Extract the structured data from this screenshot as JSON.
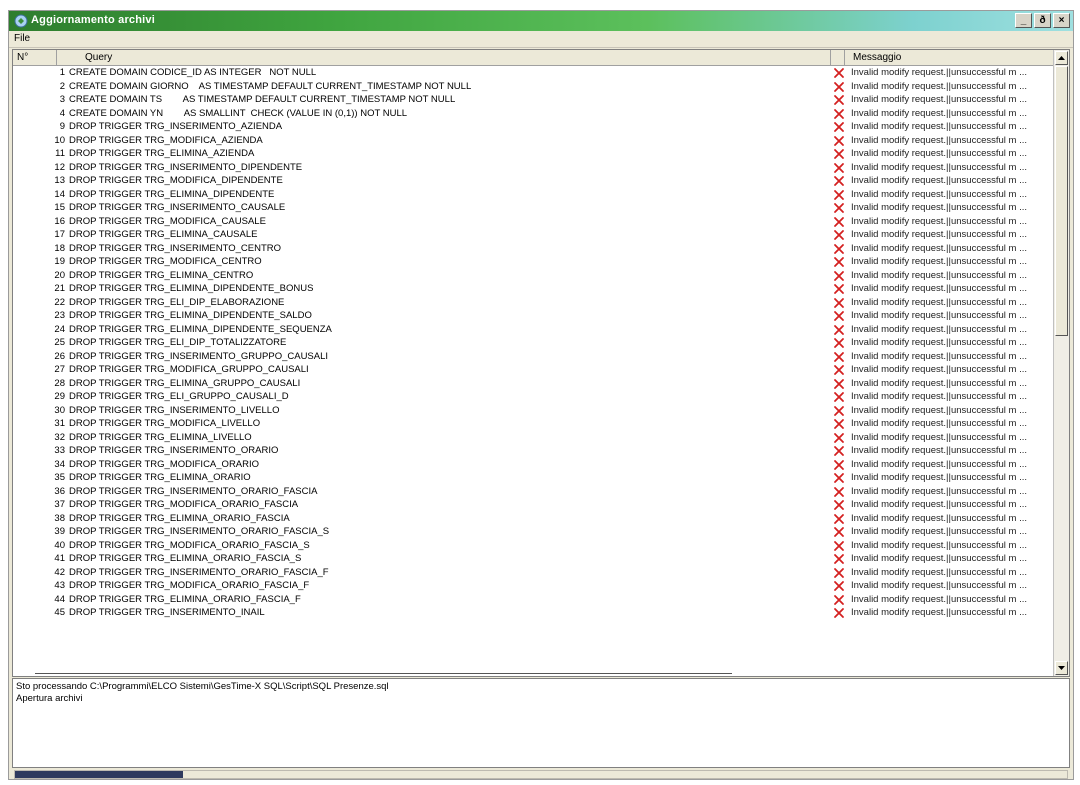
{
  "window": {
    "title": "Aggiornamento archivi",
    "controls": {
      "minimize": "_",
      "restore": "ð",
      "close": "×"
    }
  },
  "menu": {
    "file": "File"
  },
  "grid": {
    "columns": {
      "number": "N°",
      "query": "Query",
      "message": "Messaggio"
    },
    "status_icon": "red-x-icon",
    "rows": [
      {
        "n": "1",
        "query": "CREATE DOMAIN CODICE_ID AS INTEGER   NOT NULL",
        "msg": "Invalid modify request.||unsuccessful m ..."
      },
      {
        "n": "2",
        "query": "CREATE DOMAIN GIORNO    AS TIMESTAMP DEFAULT CURRENT_TIMESTAMP NOT NULL",
        "msg": "Invalid modify request.||unsuccessful m ..."
      },
      {
        "n": "3",
        "query": "CREATE DOMAIN TS        AS TIMESTAMP DEFAULT CURRENT_TIMESTAMP NOT NULL",
        "msg": "Invalid modify request.||unsuccessful m ..."
      },
      {
        "n": "4",
        "query": "CREATE DOMAIN YN        AS SMALLINT  CHECK (VALUE IN (0,1)) NOT NULL",
        "msg": "Invalid modify request.||unsuccessful m ..."
      },
      {
        "n": "9",
        "query": "DROP TRIGGER TRG_INSERIMENTO_AZIENDA",
        "msg": "Invalid modify request.||unsuccessful m ..."
      },
      {
        "n": "10",
        "query": "DROP TRIGGER TRG_MODIFICA_AZIENDA",
        "msg": "Invalid modify request.||unsuccessful m ..."
      },
      {
        "n": "11",
        "query": "DROP TRIGGER TRG_ELIMINA_AZIENDA",
        "msg": "Invalid modify request.||unsuccessful m ..."
      },
      {
        "n": "12",
        "query": "DROP TRIGGER TRG_INSERIMENTO_DIPENDENTE",
        "msg": "Invalid modify request.||unsuccessful m ..."
      },
      {
        "n": "13",
        "query": "DROP TRIGGER TRG_MODIFICA_DIPENDENTE",
        "msg": "Invalid modify request.||unsuccessful m ..."
      },
      {
        "n": "14",
        "query": "DROP TRIGGER TRG_ELIMINA_DIPENDENTE",
        "msg": "Invalid modify request.||unsuccessful m ..."
      },
      {
        "n": "15",
        "query": "DROP TRIGGER TRG_INSERIMENTO_CAUSALE",
        "msg": "Invalid modify request.||unsuccessful m ..."
      },
      {
        "n": "16",
        "query": "DROP TRIGGER TRG_MODIFICA_CAUSALE",
        "msg": "Invalid modify request.||unsuccessful m ..."
      },
      {
        "n": "17",
        "query": "DROP TRIGGER TRG_ELIMINA_CAUSALE",
        "msg": "Invalid modify request.||unsuccessful m ..."
      },
      {
        "n": "18",
        "query": "DROP TRIGGER TRG_INSERIMENTO_CENTRO",
        "msg": "Invalid modify request.||unsuccessful m ..."
      },
      {
        "n": "19",
        "query": "DROP TRIGGER TRG_MODIFICA_CENTRO",
        "msg": "Invalid modify request.||unsuccessful m ..."
      },
      {
        "n": "20",
        "query": "DROP TRIGGER TRG_ELIMINA_CENTRO",
        "msg": "Invalid modify request.||unsuccessful m ..."
      },
      {
        "n": "21",
        "query": "DROP TRIGGER TRG_ELIMINA_DIPENDENTE_BONUS",
        "msg": "Invalid modify request.||unsuccessful m ..."
      },
      {
        "n": "22",
        "query": "DROP TRIGGER TRG_ELI_DIP_ELABORAZIONE",
        "msg": "Invalid modify request.||unsuccessful m ..."
      },
      {
        "n": "23",
        "query": "DROP TRIGGER TRG_ELIMINA_DIPENDENTE_SALDO",
        "msg": "Invalid modify request.||unsuccessful m ..."
      },
      {
        "n": "24",
        "query": "DROP TRIGGER TRG_ELIMINA_DIPENDENTE_SEQUENZA",
        "msg": "Invalid modify request.||unsuccessful m ..."
      },
      {
        "n": "25",
        "query": "DROP TRIGGER TRG_ELI_DIP_TOTALIZZATORE",
        "msg": "Invalid modify request.||unsuccessful m ..."
      },
      {
        "n": "26",
        "query": "DROP TRIGGER TRG_INSERIMENTO_GRUPPO_CAUSALI",
        "msg": "Invalid modify request.||unsuccessful m ..."
      },
      {
        "n": "27",
        "query": "DROP TRIGGER TRG_MODIFICA_GRUPPO_CAUSALI",
        "msg": "Invalid modify request.||unsuccessful m ..."
      },
      {
        "n": "28",
        "query": "DROP TRIGGER TRG_ELIMINA_GRUPPO_CAUSALI",
        "msg": "Invalid modify request.||unsuccessful m ..."
      },
      {
        "n": "29",
        "query": "DROP TRIGGER TRG_ELI_GRUPPO_CAUSALI_D",
        "msg": "Invalid modify request.||unsuccessful m ..."
      },
      {
        "n": "30",
        "query": "DROP TRIGGER TRG_INSERIMENTO_LIVELLO",
        "msg": "Invalid modify request.||unsuccessful m ..."
      },
      {
        "n": "31",
        "query": "DROP TRIGGER TRG_MODIFICA_LIVELLO",
        "msg": "Invalid modify request.||unsuccessful m ..."
      },
      {
        "n": "32",
        "query": "DROP TRIGGER TRG_ELIMINA_LIVELLO",
        "msg": "Invalid modify request.||unsuccessful m ..."
      },
      {
        "n": "33",
        "query": "DROP TRIGGER TRG_INSERIMENTO_ORARIO",
        "msg": "Invalid modify request.||unsuccessful m ..."
      },
      {
        "n": "34",
        "query": "DROP TRIGGER TRG_MODIFICA_ORARIO",
        "msg": "Invalid modify request.||unsuccessful m ..."
      },
      {
        "n": "35",
        "query": "DROP TRIGGER TRG_ELIMINA_ORARIO",
        "msg": "Invalid modify request.||unsuccessful m ..."
      },
      {
        "n": "36",
        "query": "DROP TRIGGER TRG_INSERIMENTO_ORARIO_FASCIA",
        "msg": "Invalid modify request.||unsuccessful m ..."
      },
      {
        "n": "37",
        "query": "DROP TRIGGER TRG_MODIFICA_ORARIO_FASCIA",
        "msg": "Invalid modify request.||unsuccessful m ..."
      },
      {
        "n": "38",
        "query": "DROP TRIGGER TRG_ELIMINA_ORARIO_FASCIA",
        "msg": "Invalid modify request.||unsuccessful m ..."
      },
      {
        "n": "39",
        "query": "DROP TRIGGER TRG_INSERIMENTO_ORARIO_FASCIA_S",
        "msg": "Invalid modify request.||unsuccessful m ..."
      },
      {
        "n": "40",
        "query": "DROP TRIGGER TRG_MODIFICA_ORARIO_FASCIA_S",
        "msg": "Invalid modify request.||unsuccessful m ..."
      },
      {
        "n": "41",
        "query": "DROP TRIGGER TRG_ELIMINA_ORARIO_FASCIA_S",
        "msg": "Invalid modify request.||unsuccessful m ..."
      },
      {
        "n": "42",
        "query": "DROP TRIGGER TRG_INSERIMENTO_ORARIO_FASCIA_F",
        "msg": "Invalid modify request.||unsuccessful m ..."
      },
      {
        "n": "43",
        "query": "DROP TRIGGER TRG_MODIFICA_ORARIO_FASCIA_F",
        "msg": "Invalid modify request.||unsuccessful m ..."
      },
      {
        "n": "44",
        "query": "DROP TRIGGER TRG_ELIMINA_ORARIO_FASCIA_F",
        "msg": "Invalid modify request.||unsuccessful m ..."
      },
      {
        "n": "45",
        "query": "DROP TRIGGER TRG_INSERIMENTO_INAIL",
        "msg": "Invalid modify request.||unsuccessful m ..."
      }
    ]
  },
  "log": {
    "lines": [
      "Sto processando C:\\Programmi\\ELCO Sistemi\\GesTime-X SQL\\Script\\SQL Presenze.sql",
      "Apertura archivi"
    ]
  },
  "progress": {
    "fraction": 0.16
  },
  "colors": {
    "error_x": "#d42020",
    "progress_fill": "#2e3a5e"
  }
}
